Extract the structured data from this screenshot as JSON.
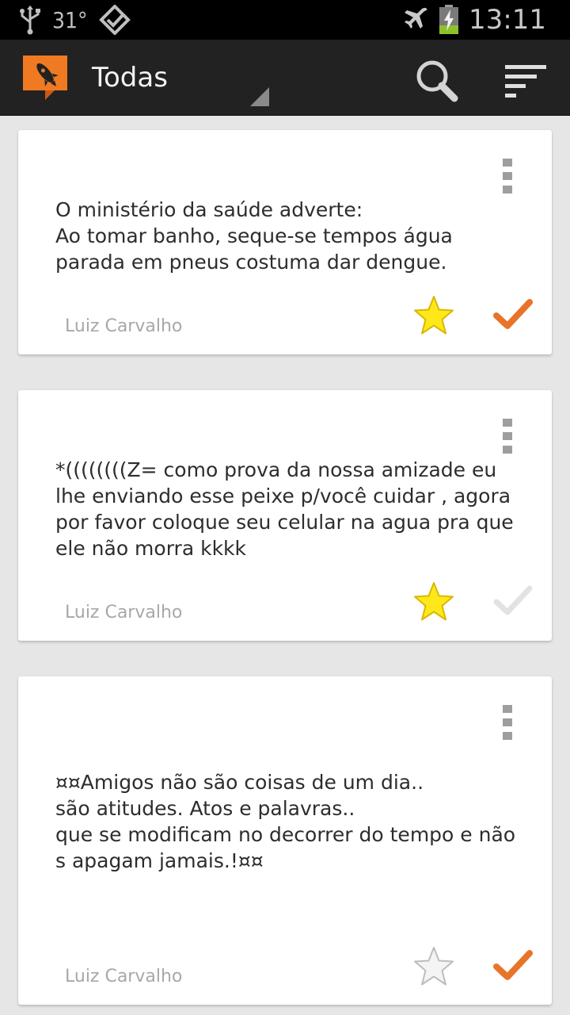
{
  "status_bar": {
    "usb_icon": "usb-icon",
    "temperature": "31°",
    "notification_icon": "check-diamond-icon",
    "airplane_icon": "airplane-icon",
    "battery_icon": "battery-charging-icon",
    "time": "13:11"
  },
  "action_bar": {
    "app_icon": "rocket-logo-icon",
    "title": "Todas",
    "search_icon": "search-icon",
    "sort_icon": "sort-icon"
  },
  "notes": [
    {
      "text": "O ministério da saúde adverte:\nAo tomar banho, seque-se tempos água parada em pneus costuma dar dengue.",
      "author": "Luiz Carvalho",
      "starred": true,
      "checked": true
    },
    {
      "text": "*((((((((Z= como prova da nossa amizade eu lhe enviando esse peixe p/você cuidar , agora por favor coloque seu celular na agua pra que ele não morra  kkkk",
      "author": "Luiz Carvalho",
      "starred": true,
      "checked": false
    },
    {
      "text": "¤¤Amigos não são coisas de um dia..\nsão atitudes. Atos e palavras..\nque se modificam no decorrer do tempo e não s apagam jamais.!¤¤",
      "author": "Luiz Carvalho",
      "starred": false,
      "checked": true
    }
  ],
  "colors": {
    "accent_orange": "#e8742a",
    "star_yellow": "#ffe81a",
    "star_outline_gray": "#c8c8c8",
    "check_inactive": "#e2e2e2",
    "action_bar": "#222222",
    "background": "#e6e6e6"
  }
}
